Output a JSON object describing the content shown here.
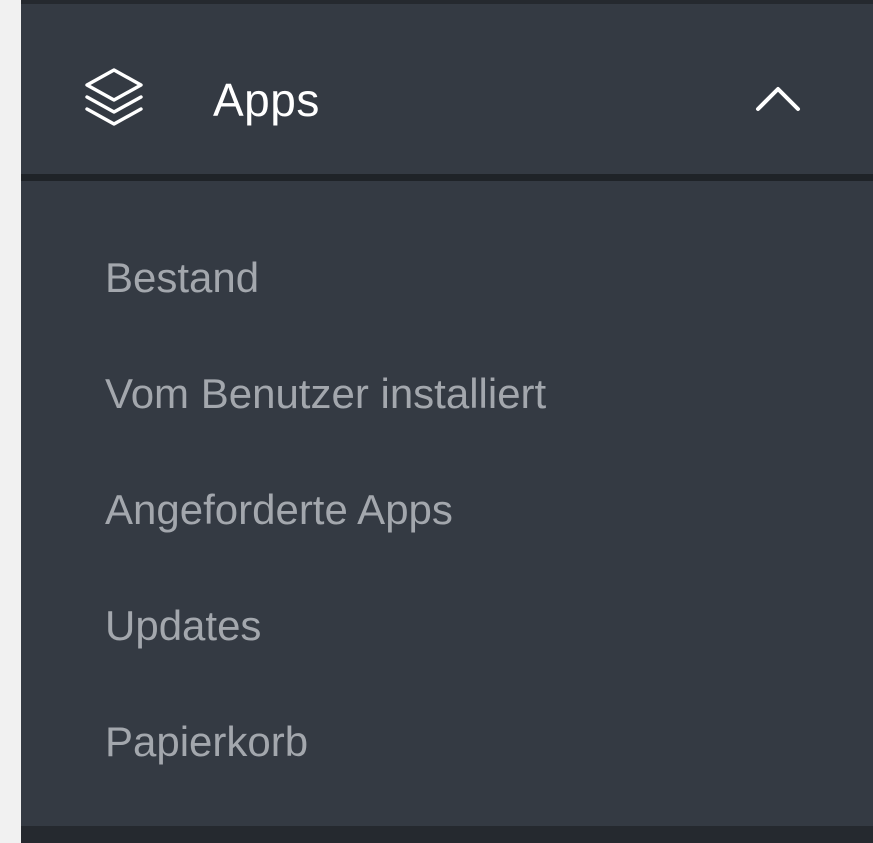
{
  "section": {
    "title": "Apps",
    "icon": "layers-icon",
    "toggle_icon": "chevron-up-icon",
    "expanded": true
  },
  "menu": {
    "items": [
      {
        "label": "Bestand"
      },
      {
        "label": "Vom Benutzer installiert"
      },
      {
        "label": "Angeforderte Apps"
      },
      {
        "label": "Updates"
      },
      {
        "label": "Papierkorb"
      }
    ]
  },
  "colors": {
    "panel_bg": "#343a43",
    "separator": "#1f2328",
    "header_text": "#ffffff",
    "item_text": "#a3a7ad",
    "page_bg": "#f1f1f1"
  }
}
